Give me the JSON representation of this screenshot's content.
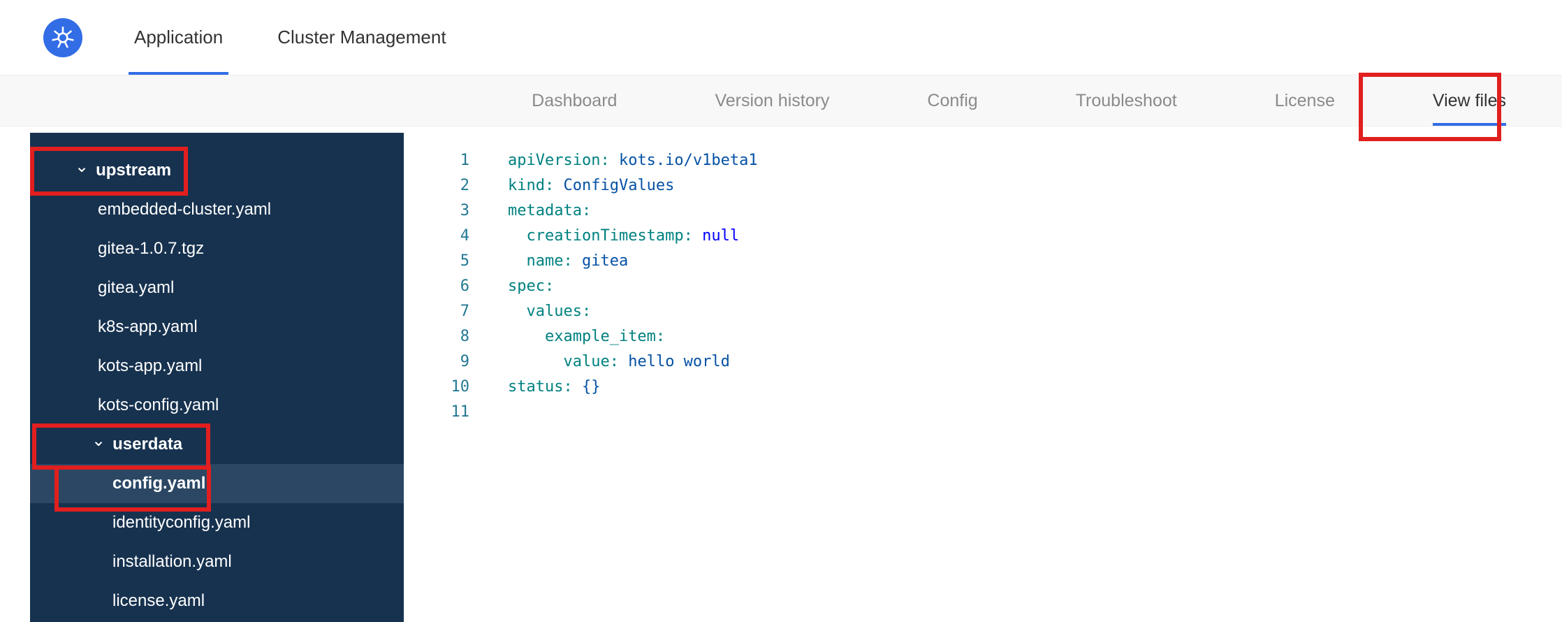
{
  "colors": {
    "annotation": "#e11f1f",
    "accent_blue": "#326de6",
    "sidebar_bg": "#17324f",
    "sidebar_selected_bg": "#2b4764"
  },
  "header": {
    "tabs": [
      {
        "id": "application",
        "label": "Application",
        "active": true
      },
      {
        "id": "cluster-management",
        "label": "Cluster Management",
        "active": false
      }
    ]
  },
  "subnav": {
    "tabs": [
      {
        "id": "dashboard",
        "label": "Dashboard",
        "active": false
      },
      {
        "id": "version-history",
        "label": "Version history",
        "active": false
      },
      {
        "id": "config",
        "label": "Config",
        "active": false
      },
      {
        "id": "troubleshoot",
        "label": "Troubleshoot",
        "active": false
      },
      {
        "id": "license",
        "label": "License",
        "active": false
      },
      {
        "id": "view-files",
        "label": "View files",
        "active": true
      }
    ]
  },
  "file_tree": {
    "items": [
      {
        "type": "dir",
        "label": "upstream",
        "level": 0,
        "expanded": true
      },
      {
        "type": "file",
        "label": "embedded-cluster.yaml",
        "level": 1
      },
      {
        "type": "file",
        "label": "gitea-1.0.7.tgz",
        "level": 1
      },
      {
        "type": "file",
        "label": "gitea.yaml",
        "level": 1
      },
      {
        "type": "file",
        "label": "k8s-app.yaml",
        "level": 1
      },
      {
        "type": "file",
        "label": "kots-app.yaml",
        "level": 1
      },
      {
        "type": "file",
        "label": "kots-config.yaml",
        "level": 1
      },
      {
        "type": "dir",
        "label": "userdata",
        "level": 1,
        "expanded": true
      },
      {
        "type": "file",
        "label": "config.yaml",
        "level": 2,
        "selected": true
      },
      {
        "type": "file",
        "label": "identityconfig.yaml",
        "level": 2
      },
      {
        "type": "file",
        "label": "installation.yaml",
        "level": 2
      },
      {
        "type": "file",
        "label": "license.yaml",
        "level": 2
      }
    ]
  },
  "editor": {
    "token_colors": {
      "key": "#008080",
      "val": "#0451a5",
      "kw": "#0000ff",
      "plain": "#000000",
      "line_number": "#237893"
    },
    "lines": [
      {
        "num": "1",
        "tokens": [
          {
            "c": "key",
            "t": "apiVersion:"
          },
          {
            "c": "val",
            "t": " kots.io/v1beta1"
          }
        ]
      },
      {
        "num": "2",
        "tokens": [
          {
            "c": "key",
            "t": "kind:"
          },
          {
            "c": "val",
            "t": " ConfigValues"
          }
        ]
      },
      {
        "num": "3",
        "tokens": [
          {
            "c": "key",
            "t": "metadata:"
          }
        ]
      },
      {
        "num": "4",
        "tokens": [
          {
            "c": "plain",
            "t": "  "
          },
          {
            "c": "key",
            "t": "creationTimestamp:"
          },
          {
            "c": "kw",
            "t": " null"
          }
        ]
      },
      {
        "num": "5",
        "tokens": [
          {
            "c": "plain",
            "t": "  "
          },
          {
            "c": "key",
            "t": "name:"
          },
          {
            "c": "val",
            "t": " gitea"
          }
        ]
      },
      {
        "num": "6",
        "tokens": [
          {
            "c": "key",
            "t": "spec:"
          }
        ]
      },
      {
        "num": "7",
        "tokens": [
          {
            "c": "plain",
            "t": "  "
          },
          {
            "c": "key",
            "t": "values:"
          }
        ]
      },
      {
        "num": "8",
        "tokens": [
          {
            "c": "plain",
            "t": "    "
          },
          {
            "c": "key",
            "t": "example_item:"
          }
        ]
      },
      {
        "num": "9",
        "tokens": [
          {
            "c": "plain",
            "t": "      "
          },
          {
            "c": "key",
            "t": "value:"
          },
          {
            "c": "val",
            "t": " hello world"
          }
        ]
      },
      {
        "num": "10",
        "tokens": [
          {
            "c": "key",
            "t": "status:"
          },
          {
            "c": "val",
            "t": " {}"
          }
        ]
      },
      {
        "num": "11",
        "tokens": []
      }
    ]
  },
  "annotations": [
    {
      "target": "view-files-tab"
    },
    {
      "target": "upstream-dir"
    },
    {
      "target": "userdata-dir"
    },
    {
      "target": "config-yaml-file"
    }
  ]
}
